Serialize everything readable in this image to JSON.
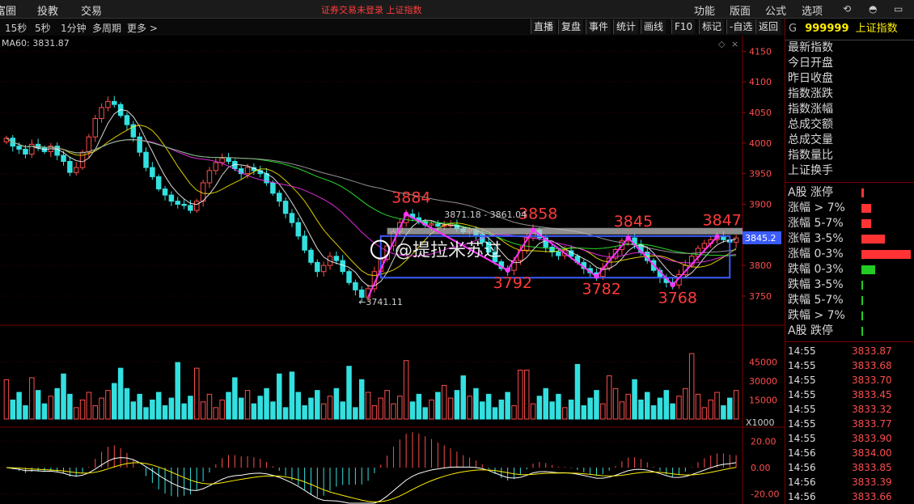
{
  "topbar": {
    "menus": [
      "富圈",
      "投教",
      "交易"
    ],
    "notice": "证券交易未登录  上证指数",
    "right_menus": [
      "功能",
      "版面",
      "公式",
      "选项"
    ]
  },
  "subbar": {
    "periods": [
      "15秒",
      "5秒",
      "1分钟",
      "多周期",
      "更多 >"
    ],
    "buttons": [
      "直播",
      "复盘",
      "事件",
      "统计",
      "画线",
      "F10",
      "标记",
      "-自选",
      "返回"
    ]
  },
  "ma_label": "MA60: 3831.87",
  "side": {
    "code_prefix": "G",
    "code": "999999",
    "name": "上证指数",
    "fields": [
      "最新指数",
      "今日开盘",
      "昨日收盘",
      "指数涨跌",
      "指数涨幅",
      "总成交额",
      "总成交量",
      "指数量比",
      "上证换手"
    ],
    "dist": [
      {
        "label": "A股 涨停",
        "fill": 0.02,
        "color": "#ff3333"
      },
      {
        "label": "涨幅 > 7%",
        "fill": 0.09,
        "color": "#ff3333"
      },
      {
        "label": "涨幅 5-7%",
        "fill": 0.09,
        "color": "#ff3333"
      },
      {
        "label": "涨幅 3-5%",
        "fill": 0.22,
        "color": "#ff3333"
      },
      {
        "label": "涨幅 0-3%",
        "fill": 0.47,
        "color": "#ff3333"
      },
      {
        "label": "跌幅 0-3%",
        "fill": 0.13,
        "color": "#22cc22"
      },
      {
        "label": "跌幅 3-5%",
        "fill": 0.01,
        "color": "#22cc22"
      },
      {
        "label": "跌幅 5-7%",
        "fill": 0.01,
        "color": "#22cc22"
      },
      {
        "label": "跌幅 > 7%",
        "fill": 0.01,
        "color": "#22cc22"
      },
      {
        "label": "A股 跌停",
        "fill": 0.01,
        "color": "#22cc22"
      }
    ],
    "ticks": [
      {
        "time": "14:55",
        "price": "3833.87"
      },
      {
        "time": "14:55",
        "price": "3833.68"
      },
      {
        "time": "14:55",
        "price": "3833.70"
      },
      {
        "time": "14:55",
        "price": "3833.45"
      },
      {
        "time": "14:55",
        "price": "3833.32"
      },
      {
        "time": "14:55",
        "price": "3833.77"
      },
      {
        "time": "14:55",
        "price": "3833.90"
      },
      {
        "time": "14:56",
        "price": "3834.00"
      },
      {
        "time": "14:56",
        "price": "3833.85"
      },
      {
        "time": "14:56",
        "price": "3833.39"
      },
      {
        "time": "14:56",
        "price": "3833.66"
      }
    ]
  },
  "chart_data": {
    "type": "candlestick",
    "price_axis": {
      "ticks": [
        4150,
        4100,
        4050,
        4000,
        3950,
        3900,
        3850,
        3800,
        3750
      ],
      "range": [
        3705,
        4165
      ]
    },
    "price_label": "3845.2",
    "volume_axis": {
      "ticks": [
        "45000",
        "30000",
        "15000",
        "X1000"
      ],
      "max": 56000
    },
    "macd_axis": {
      "ticks": [
        "20.00",
        "0.00",
        "-20.00"
      ],
      "range": [
        -27,
        27
      ]
    },
    "close_series": [
      4008,
      3995,
      3990,
      3982,
      3998,
      3992,
      3986,
      3995,
      3980,
      3970,
      3952,
      3960,
      3985,
      4010,
      4040,
      4058,
      4068,
      4063,
      4045,
      4030,
      4010,
      3985,
      3960,
      3945,
      3925,
      3915,
      3905,
      3900,
      3898,
      3890,
      3905,
      3935,
      3955,
      3968,
      3975,
      3970,
      3958,
      3950,
      3960,
      3955,
      3950,
      3935,
      3918,
      3905,
      3885,
      3870,
      3848,
      3825,
      3805,
      3790,
      3800,
      3815,
      3808,
      3790,
      3772,
      3760,
      3748,
      3762,
      3790,
      3810,
      3832,
      3855,
      3870,
      3884,
      3878,
      3872,
      3866,
      3868,
      3864,
      3866,
      3866,
      3860,
      3855,
      3858,
      3850,
      3838,
      3822,
      3806,
      3795,
      3792,
      3808,
      3825,
      3845,
      3858,
      3845,
      3830,
      3822,
      3816,
      3824,
      3815,
      3805,
      3795,
      3788,
      3782,
      3796,
      3812,
      3826,
      3840,
      3845,
      3834,
      3822,
      3808,
      3792,
      3780,
      3772,
      3768,
      3785,
      3800,
      3815,
      3828,
      3836,
      3842,
      3847,
      3842,
      3838,
      3845
    ],
    "annotations": [
      {
        "text": "3884",
        "index": 63,
        "price": 3884,
        "pos": "above"
      },
      {
        "text": "3858",
        "index": 83,
        "price": 3858,
        "pos": "above"
      },
      {
        "text": "3845",
        "index": 98,
        "price": 3845,
        "pos": "above"
      },
      {
        "text": "3847",
        "index": 112,
        "price": 3847,
        "pos": "above"
      },
      {
        "text": "3792",
        "index": 79,
        "price": 3792,
        "pos": "below"
      },
      {
        "text": "3782",
        "index": 93,
        "price": 3782,
        "pos": "below"
      },
      {
        "text": "3768",
        "index": 105,
        "price": 3768,
        "pos": "below"
      }
    ],
    "range_label": "3871.18 - 3861.04",
    "low_label": "←3741.11",
    "box": {
      "start_index": 59,
      "end_index": 114,
      "price_top": 3848,
      "price_bottom": 3780
    },
    "ma_colors": [
      "#ffffff",
      "#ffee00",
      "#ff33ff",
      "#33ff33",
      "#aaaaaa"
    ],
    "watermark": "@提拉米苏过"
  }
}
